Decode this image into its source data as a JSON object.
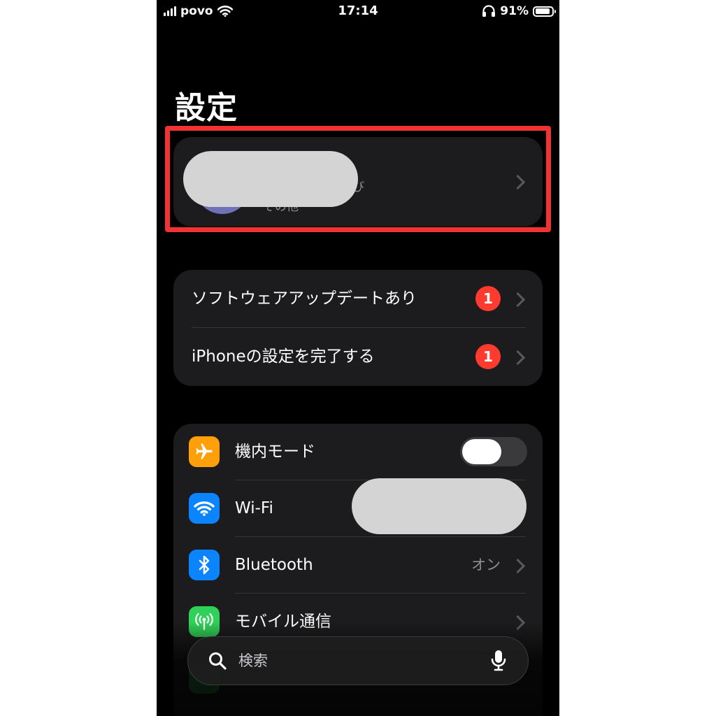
{
  "status_bar": {
    "carrier": "povo",
    "time": "17:14",
    "battery_percent": "91%",
    "battery_level": 0.91,
    "icons": [
      "signal-icon",
      "wifi-icon",
      "headphones-icon",
      "battery-icon"
    ]
  },
  "page": {
    "title": "設定"
  },
  "profile": {
    "subtitle": "t、iCloud、および\nその他",
    "name_redacted": true,
    "colors": {
      "avatar": "#6f72b8",
      "highlight_border": "#f03333"
    }
  },
  "updates": {
    "items": [
      {
        "label": "ソフトウェアアップデートあり",
        "badge": "1"
      },
      {
        "label": "iPhoneの設定を完了する",
        "badge": "1"
      }
    ],
    "badge_color": "#ff3b30"
  },
  "connectivity": {
    "items": [
      {
        "label": "機内モード",
        "icon": "airplane-icon",
        "icon_color": "#ff9f0a",
        "toggle_on": false
      },
      {
        "label": "Wi-Fi",
        "icon": "wifi-icon",
        "icon_color": "#0a84ff",
        "value_redacted": true
      },
      {
        "label": "Bluetooth",
        "icon": "bluetooth-icon",
        "icon_color": "#0a84ff",
        "value": "オン"
      },
      {
        "label": "モバイル通信",
        "icon": "antenna-icon",
        "icon_color": "#30d158"
      }
    ]
  },
  "search": {
    "placeholder": "検索",
    "icons": [
      "search-icon",
      "mic-icon"
    ]
  }
}
